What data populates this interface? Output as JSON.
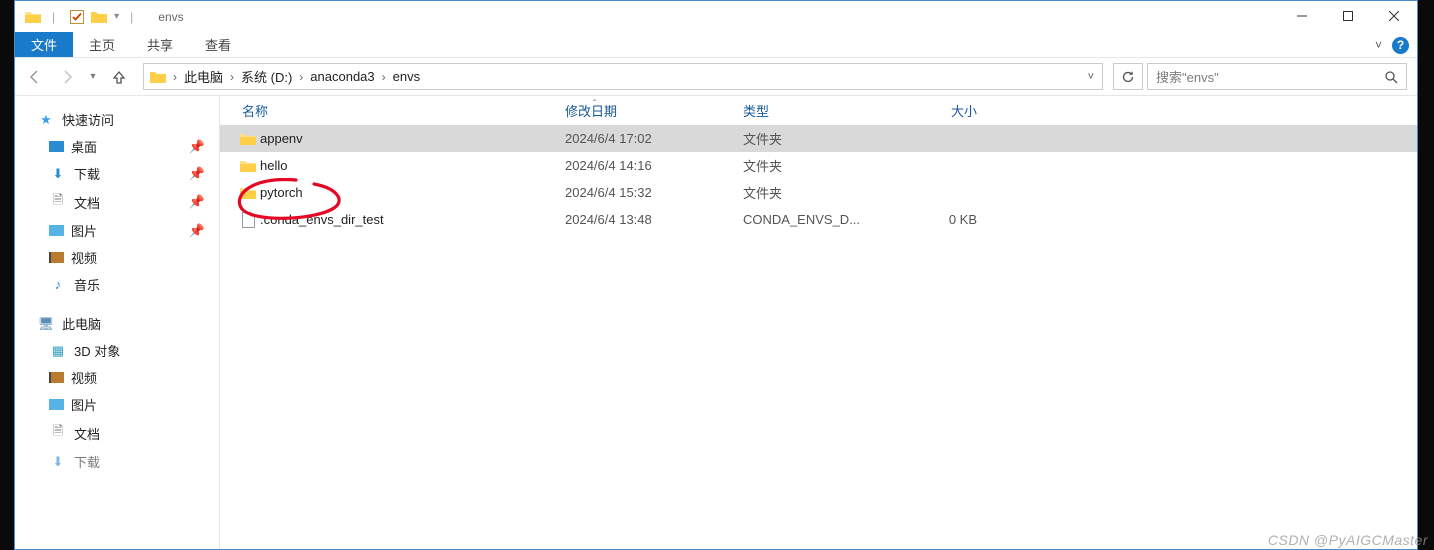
{
  "titlebar": {
    "title": "envs",
    "separator": "|"
  },
  "ribbon": {
    "file": "文件",
    "tabs": [
      "主页",
      "共享",
      "查看"
    ]
  },
  "breadcrumb": {
    "items": [
      "此电脑",
      "系统 (D:)",
      "anaconda3",
      "envs"
    ]
  },
  "search": {
    "placeholder": "搜索\"envs\""
  },
  "sidebar": {
    "quick_access": "快速访问",
    "quick_items": [
      {
        "label": "桌面"
      },
      {
        "label": "下载"
      },
      {
        "label": "文档"
      },
      {
        "label": "图片"
      },
      {
        "label": "视频"
      },
      {
        "label": "音乐"
      }
    ],
    "this_pc": "此电脑",
    "pc_items": [
      {
        "label": "3D 对象"
      },
      {
        "label": "视频"
      },
      {
        "label": "图片"
      },
      {
        "label": "文档"
      },
      {
        "label": "下载"
      }
    ]
  },
  "columns": {
    "name": "名称",
    "date": "修改日期",
    "type": "类型",
    "size": "大小"
  },
  "files": [
    {
      "name": "appenv",
      "date": "2024/6/4 17:02",
      "type": "文件夹",
      "size": "",
      "kind": "folder",
      "selected": true
    },
    {
      "name": "hello",
      "date": "2024/6/4 14:16",
      "type": "文件夹",
      "size": "",
      "kind": "folder",
      "selected": false
    },
    {
      "name": "pytorch",
      "date": "2024/6/4 15:32",
      "type": "文件夹",
      "size": "",
      "kind": "folder",
      "selected": false
    },
    {
      "name": ".conda_envs_dir_test",
      "date": "2024/6/4 13:48",
      "type": "CONDA_ENVS_D...",
      "size": "0 KB",
      "kind": "file",
      "selected": false
    }
  ],
  "watermark": "CSDN @PyAIGCMaster"
}
